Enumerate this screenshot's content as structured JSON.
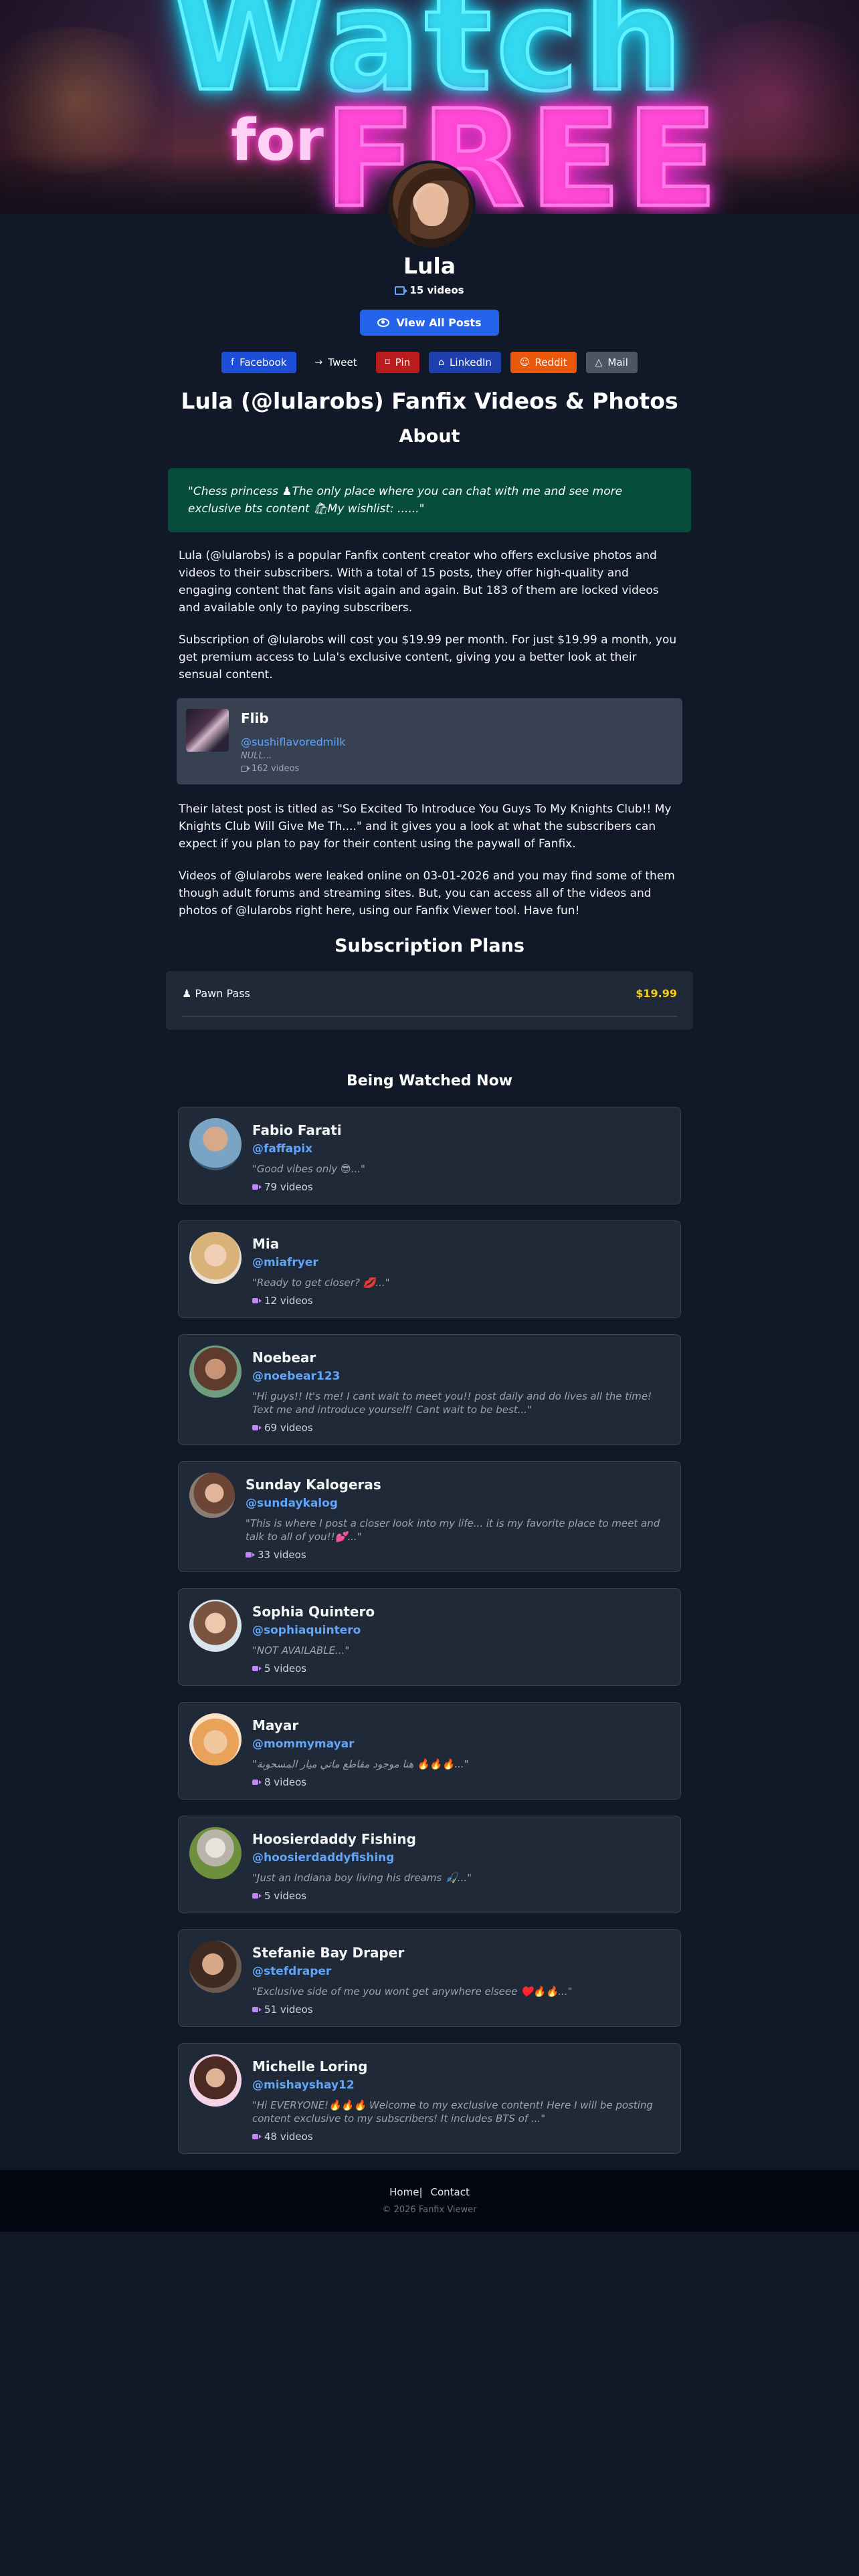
{
  "hero": {
    "neon_top": "Watch",
    "neon_for": "for",
    "neon_free": "FREE",
    "colors": {
      "cyan": "#5ef3ff",
      "pink": "#ff79e8"
    }
  },
  "profile": {
    "name": "Lula",
    "video_count": "15 videos",
    "view_all": "View All Posts"
  },
  "share": [
    {
      "label": "Facebook",
      "icon": "f",
      "color": "#1d4ed8"
    },
    {
      "label": "Tweet",
      "icon": "→",
      "color": "#111827"
    },
    {
      "label": "Pin",
      "icon": "⌑",
      "color": "#b91c1c"
    },
    {
      "label": "LinkedIn",
      "icon": "⌂",
      "color": "#1e40af"
    },
    {
      "label": "Reddit",
      "icon": "☺",
      "color": "#ea580c"
    },
    {
      "label": "Mail",
      "icon": "△",
      "color": "#4b5563"
    }
  ],
  "page_title": "Lula (@lularobs) Fanfix Videos & Photos",
  "about_heading": "About",
  "quote": "\"Chess princess ♟The only place where you can chat with me and see more exclusive bts content 🛍My wishlist: ......\"",
  "paragraphs": {
    "p1": "Lula (@lularobs) is a popular Fanfix content creator who offers exclusive photos and videos to their subscribers. With a total of 15 posts, they offer high-quality and engaging content that fans visit again and again. But 183 of them are locked videos and available only to paying subscribers.",
    "p2": "Subscription of @lularobs will cost you $19.99 per month. For just $19.99 a month, you get premium access to Lula's exclusive content, giving you a better look at their sensual content.",
    "p3": "Their latest post is titled as \"So Excited To Introduce You Guys To My Knights Club!! My Knights Club Will Give Me Th....\" and it gives you a look at what the subscribers can expect if you plan to pay for their content using the paywall of Fanfix.",
    "p4": "Videos of @lularobs were leaked online on 03-01-2026 and you may find some of them though adult forums and streaming sites. But, you can access all of the videos and photos of @lularobs right here, using our Fanfix Viewer tool. Have fun!"
  },
  "flib": {
    "name": "Flib",
    "handle": "@sushiflavoredmilk",
    "bio": "NULL...",
    "videos": "162 videos"
  },
  "plans_heading": "Subscription Plans",
  "plan": {
    "name": "♟ Pawn Pass",
    "price": "$19.99"
  },
  "watching_heading": "Being Watched Now",
  "creators": [
    {
      "name": "Fabio Farati",
      "handle": "@faffapix",
      "bio": "\"Good vibes only 😎...\"",
      "videos": "79 videos"
    },
    {
      "name": "Mia",
      "handle": "@miafryer",
      "bio": "\"Ready to get closer? 💋...\"",
      "videos": "12 videos"
    },
    {
      "name": "Noebear",
      "handle": "@noebear123",
      "bio": "\"Hi guys!! It's me! I cant wait to meet you!! post daily and do lives all the time! Text me and introduce yourself! Cant wait to be best...\"",
      "videos": "69 videos"
    },
    {
      "name": "Sunday Kalogeras",
      "handle": "@sundaykalog",
      "bio": "\"This is where I post a closer look into my life... it is my favorite place to meet and talk to all of you!!💕...\"",
      "videos": "33 videos"
    },
    {
      "name": "Sophia Quintero",
      "handle": "@sophiaquintero",
      "bio": "\"NOT AVAILABLE...\"",
      "videos": "5 videos"
    },
    {
      "name": "Mayar",
      "handle": "@mommymayar",
      "bio": "\"هنا موجود مقاطع ماتي ميار المسحوبة 🔥🔥🔥...\"",
      "videos": "8 videos"
    },
    {
      "name": "Hoosierdaddy Fishing",
      "handle": "@hoosierdaddyfishing",
      "bio": "\"Just an Indiana boy living his dreams 🎣...\"",
      "videos": "5 videos"
    },
    {
      "name": "Stefanie Bay Draper",
      "handle": "@stefdraper",
      "bio": "\"Exclusive side of me you wont get anywhere elseee ♥️🔥🔥...\"",
      "videos": "51 videos"
    },
    {
      "name": "Michelle Loring",
      "handle": "@mishayshay12",
      "bio": "\"Hi EVERYONE!🔥🔥🔥 Welcome to my exclusive content! Here I will be posting content exclusive to my subscribers! It includes BTS of ...\"",
      "videos": "48 videos"
    }
  ],
  "footer": {
    "home": "Home",
    "sep": "|",
    "contact": "Contact",
    "copyright": "© 2026 Fanfix Viewer"
  }
}
